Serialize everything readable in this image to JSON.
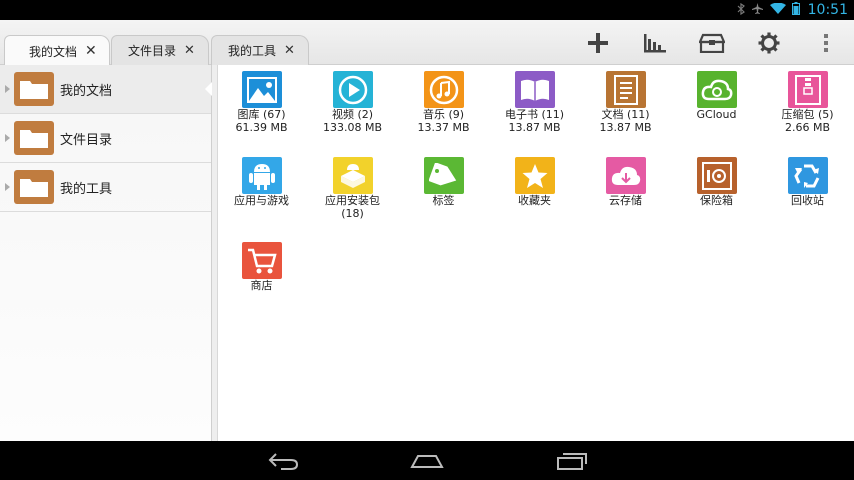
{
  "status": {
    "time": "10:51"
  },
  "tabs": [
    {
      "label": "我的文档",
      "close": "✕"
    },
    {
      "label": "文件目录",
      "close": "✕"
    },
    {
      "label": "我的工具",
      "close": "✕"
    }
  ],
  "sidebar": {
    "items": [
      {
        "label": "我的文档"
      },
      {
        "label": "文件目录"
      },
      {
        "label": "我的工具"
      }
    ]
  },
  "grid": {
    "items": [
      {
        "title": "图库 (67)",
        "sub": "61.39 MB",
        "icon": "gallery-icon",
        "color": "#1d8fd8"
      },
      {
        "title": "视频 (2)",
        "sub": "133.08 MB",
        "icon": "video-icon",
        "color": "#25b3d6"
      },
      {
        "title": "音乐 (9)",
        "sub": "13.37 MB",
        "icon": "music-icon",
        "color": "#f39418"
      },
      {
        "title": "电子书 (11)",
        "sub": "13.87 MB",
        "icon": "ebook-icon",
        "color": "#8c5bc6"
      },
      {
        "title": "文档 (11)",
        "sub": "13.87 MB",
        "icon": "document-icon",
        "color": "#b87433"
      },
      {
        "title": "GCloud",
        "sub": "",
        "icon": "gcloud-icon",
        "color": "#58b32e"
      },
      {
        "title": "压缩包 (5)",
        "sub": "2.66 MB",
        "icon": "archive-icon",
        "color": "#e8559a"
      },
      {
        "title": "应用与游戏",
        "sub": "",
        "icon": "android-icon",
        "color": "#33a7e8"
      },
      {
        "title": "应用安装包",
        "sub": "(18)",
        "icon": "apk-icon",
        "color": "#f2d22b"
      },
      {
        "title": "标签",
        "sub": "",
        "icon": "tag-icon",
        "color": "#5bb834"
      },
      {
        "title": "收藏夹",
        "sub": "",
        "icon": "star-icon",
        "color": "#f2b319"
      },
      {
        "title": "云存储",
        "sub": "",
        "icon": "cloud-icon",
        "color": "#e55aa3"
      },
      {
        "title": "保险箱",
        "sub": "",
        "icon": "safe-icon",
        "color": "#b7612c"
      },
      {
        "title": "回收站",
        "sub": "",
        "icon": "recycle-icon",
        "color": "#2f97e0"
      },
      {
        "title": "商店",
        "sub": "",
        "icon": "shop-icon",
        "color": "#e9543d"
      }
    ]
  }
}
